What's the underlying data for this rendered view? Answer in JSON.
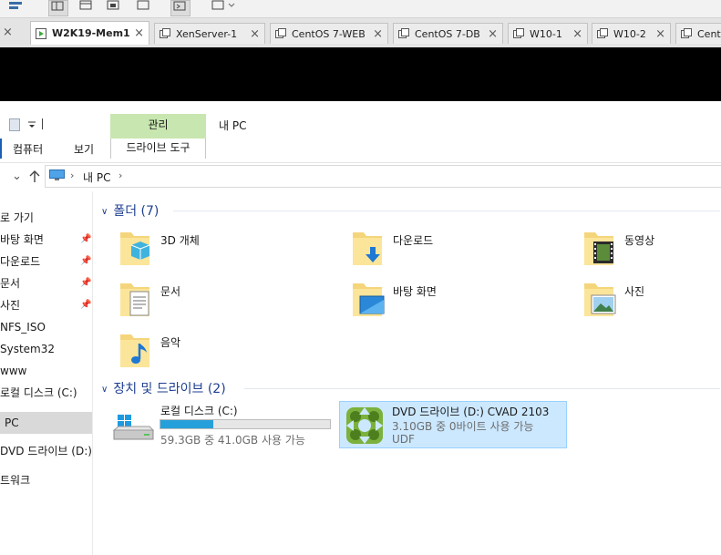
{
  "vm_tabs": [
    {
      "label": "W2K19-Mem1",
      "active": true
    },
    {
      "label": "XenServer-1"
    },
    {
      "label": "CentOS 7-WEB"
    },
    {
      "label": "CentOS 7-DB"
    },
    {
      "label": "W10-1"
    },
    {
      "label": "W10-2"
    },
    {
      "label": "CentO"
    }
  ],
  "tab_close_glyph": "×",
  "ribbon": {
    "manage_tab": "관리",
    "title": "내 PC",
    "computer_tab": "컴퓨터",
    "view_tab": "보기",
    "drive_tools_tab": "드라이브 도구"
  },
  "address": {
    "location": "내 PC",
    "separator": "›"
  },
  "nav": {
    "items": [
      {
        "label": "로 가기"
      },
      {
        "label": "바탕 화면",
        "pinned": true
      },
      {
        "label": "다운로드",
        "pinned": true
      },
      {
        "label": "문서",
        "pinned": true
      },
      {
        "label": "사진",
        "pinned": true
      },
      {
        "label": "NFS_ISO"
      },
      {
        "label": "System32"
      },
      {
        "label": "www"
      },
      {
        "label": "로컬 디스크 (C:)"
      },
      {
        "label": "PC",
        "selected": true
      },
      {
        "label": "DVD 드라이브 (D:) C"
      },
      {
        "label": "트워크"
      }
    ]
  },
  "folders_group": {
    "title": "폴더 (7)",
    "items": [
      {
        "label": "3D 개체",
        "icon": "3d-objects-folder-icon"
      },
      {
        "label": "다운로드",
        "icon": "downloads-folder-icon"
      },
      {
        "label": "동영상",
        "icon": "videos-folder-icon"
      },
      {
        "label": "문서",
        "icon": "documents-folder-icon"
      },
      {
        "label": "바탕 화면",
        "icon": "desktop-folder-icon"
      },
      {
        "label": "사진",
        "icon": "pictures-folder-icon"
      },
      {
        "label": "음악",
        "icon": "music-folder-icon"
      }
    ]
  },
  "drives_group": {
    "title": "장치 및 드라이브 (2)",
    "drives": [
      {
        "label": "로컬 디스크 (C:)",
        "free_text": "59.3GB 중 41.0GB 사용 가능",
        "used_fraction": 0.31,
        "icon": "hard-drive-icon"
      },
      {
        "label": "DVD 드라이브 (D:) CVAD 2103",
        "free_text": "3.10GB 중 0바이트 사용 가능",
        "filesystem": "UDF",
        "selected": true,
        "icon": "citrix-dvd-icon"
      }
    ]
  },
  "colors": {
    "manage_tab_bg": "#c8e6b0",
    "group_header": "#1e3f8f",
    "usage_bar": "#26a0da",
    "selection_bg": "#cce8ff"
  }
}
